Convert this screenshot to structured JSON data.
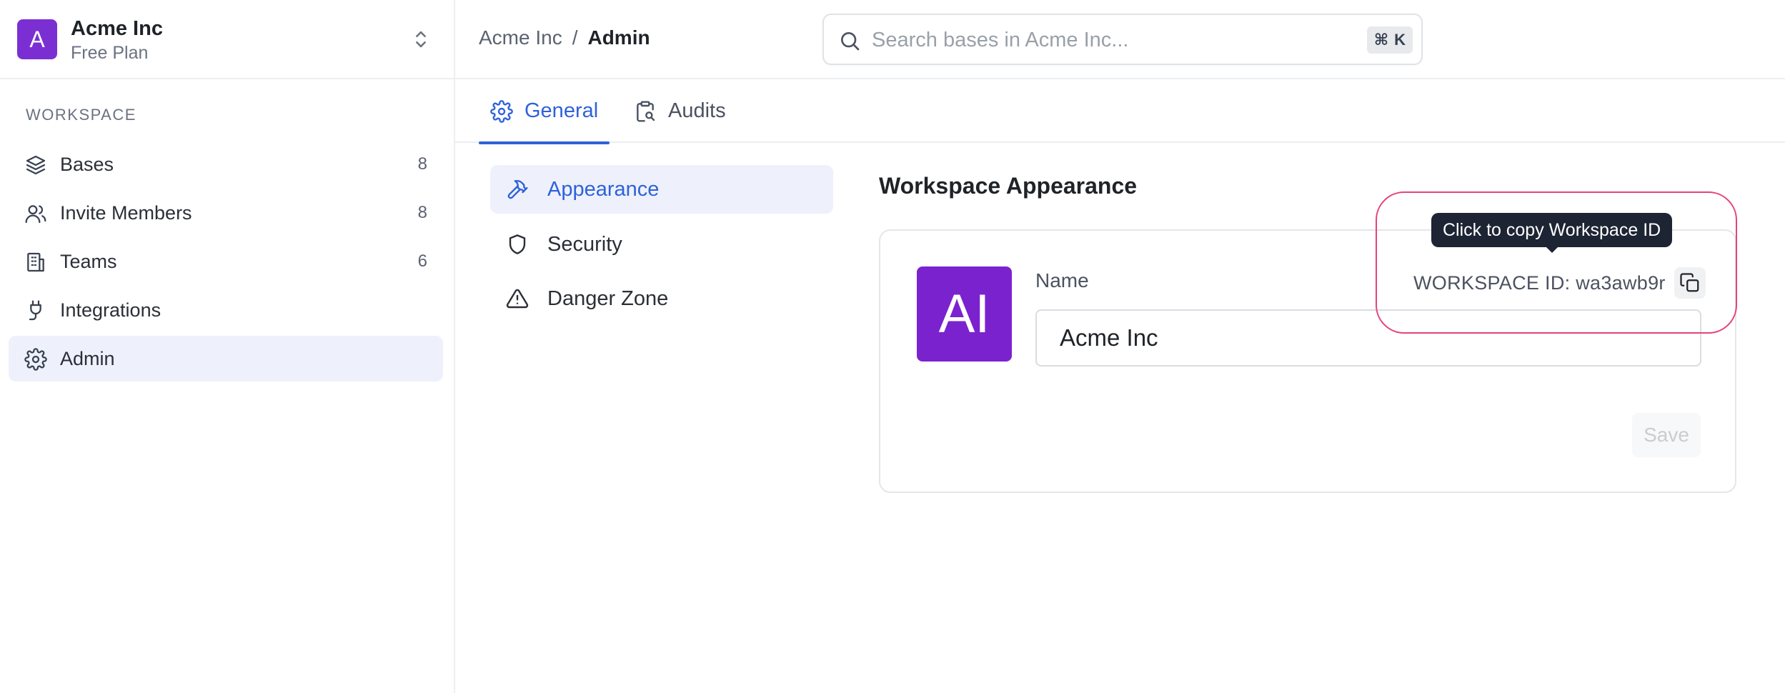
{
  "workspace": {
    "avatar_letter": "A",
    "name": "Acme Inc",
    "plan": "Free Plan",
    "accent_color": "#7b2fd3"
  },
  "sidebar": {
    "section_label": "WORKSPACE",
    "items": [
      {
        "label": "Bases",
        "count": "8",
        "icon": "layers-icon"
      },
      {
        "label": "Invite Members",
        "count": "8",
        "icon": "users-icon"
      },
      {
        "label": "Teams",
        "count": "6",
        "icon": "building-icon"
      },
      {
        "label": "Integrations",
        "count": "",
        "icon": "plug-icon"
      },
      {
        "label": "Admin",
        "count": "",
        "icon": "gear-icon",
        "active": true
      }
    ]
  },
  "header": {
    "breadcrumb": [
      "Acme Inc",
      "/",
      "Admin"
    ],
    "search_placeholder": "Search bases in Acme Inc...",
    "search_shortcut_symbol": "⌘",
    "search_shortcut_key": "K"
  },
  "tabs": [
    {
      "label": "General",
      "icon": "gear-icon",
      "active": true
    },
    {
      "label": "Audits",
      "icon": "clipboard-search-icon",
      "active": false
    }
  ],
  "subnav": [
    {
      "label": "Appearance",
      "icon": "hammer-icon",
      "active": true
    },
    {
      "label": "Security",
      "icon": "shield-icon",
      "active": false
    },
    {
      "label": "Danger Zone",
      "icon": "warning-icon",
      "active": false
    }
  ],
  "appearance": {
    "title": "Workspace Appearance",
    "avatar_initials": "AI",
    "avatar_color": "#7b22cf",
    "name_label": "Name",
    "name_value": "Acme Inc",
    "workspace_id_label": "WORKSPACE ID: wa3awb9r",
    "copy_tooltip": "Click to copy Workspace ID",
    "save_label": "Save"
  },
  "colors": {
    "primary": "#2f62d9",
    "active_bg": "#eef1fc",
    "highlight": "#e5437b"
  }
}
